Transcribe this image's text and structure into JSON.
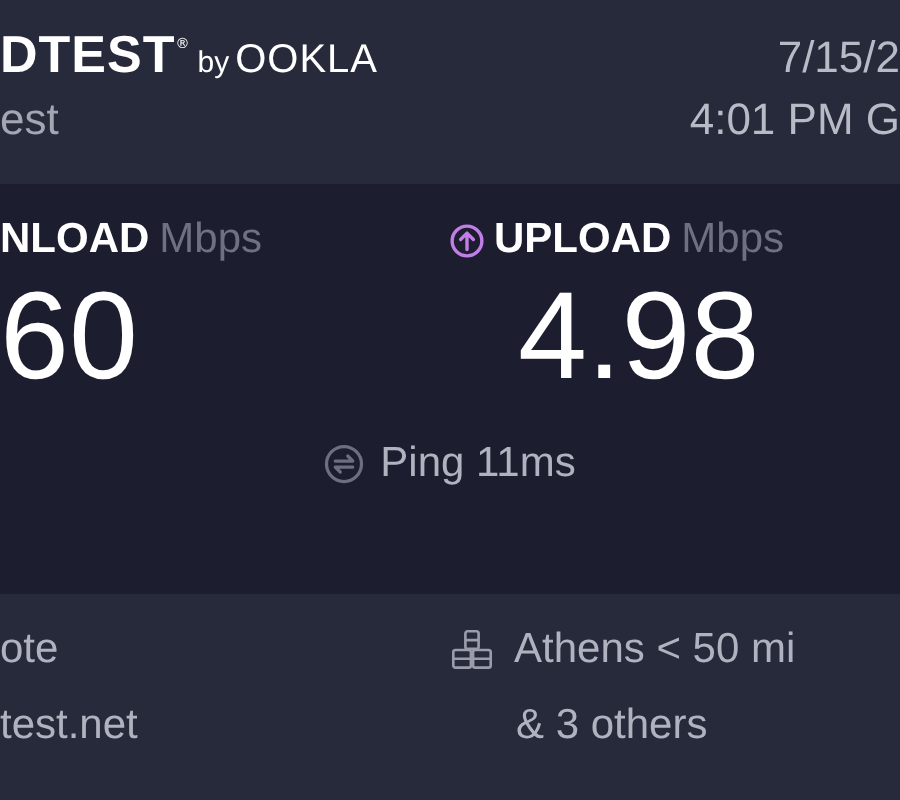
{
  "header": {
    "wordmark": "DTEST",
    "registered": "®",
    "byline": "by",
    "brand": "OOKLA",
    "subtitle": "est",
    "date": "7/15/2",
    "time": "4:01 PM G"
  },
  "results": [
    {
      "kind": "download",
      "label": "NLOAD",
      "unit": "Mbps",
      "value": "60"
    },
    {
      "kind": "upload",
      "label": "UPLOAD",
      "unit": "Mbps",
      "value": "4.98"
    }
  ],
  "ping": {
    "label": "Ping 11ms"
  },
  "server": {
    "provider_lines": [
      "ote",
      "test.net"
    ],
    "location": "Athens < 50 mi",
    "others": "& 3 others"
  }
}
